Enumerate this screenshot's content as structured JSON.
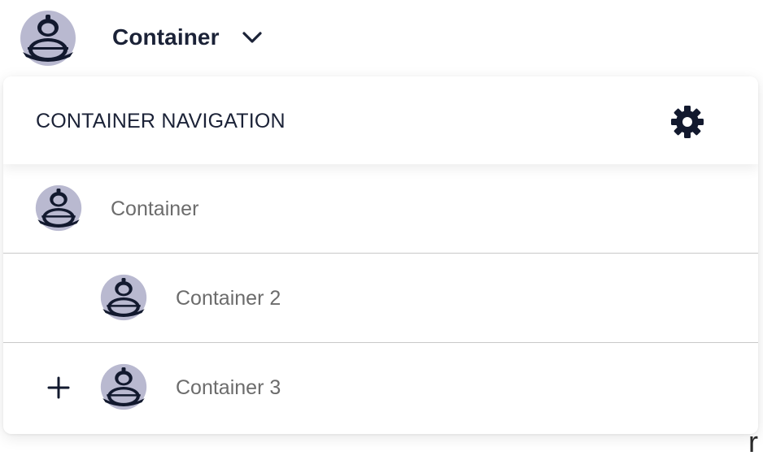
{
  "header": {
    "title": "Container",
    "avatar_icon": "container-avatar-icon",
    "dropdown_icon": "chevron-down-icon"
  },
  "dropdown": {
    "title": "CONTAINER NAVIGATION",
    "settings_icon": "gear-icon",
    "items": [
      {
        "label": "Container",
        "icon": "container-avatar-icon"
      },
      {
        "label": "Container 2",
        "icon": "container-avatar-icon"
      },
      {
        "label": "Container 3",
        "icon": "container-avatar-icon",
        "action_icon": "plus-icon"
      }
    ]
  },
  "background": {
    "partial_text": "r"
  },
  "colors": {
    "text_dark": "#1b2237",
    "text_muted": "#6c6c6c",
    "avatar_fill": "#b9b9d0",
    "avatar_dark": "#12192e",
    "divider": "#c9c9c9"
  }
}
